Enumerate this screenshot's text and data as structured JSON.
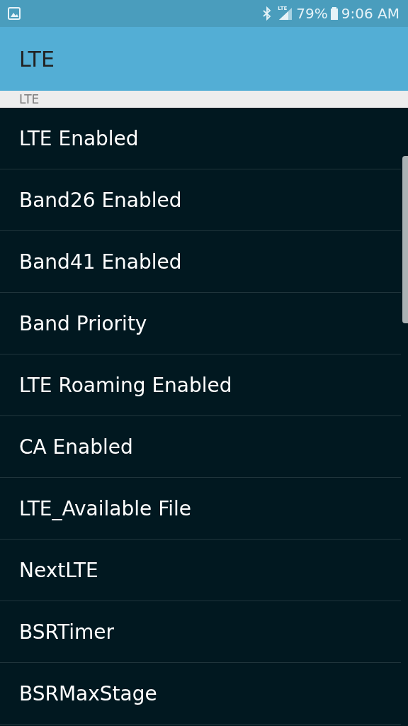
{
  "status_bar": {
    "battery": "79%",
    "time": "9:06 AM",
    "network": "LTE"
  },
  "app_bar": {
    "title": "LTE"
  },
  "section_header": "LTE",
  "items": [
    "LTE Enabled",
    "Band26 Enabled",
    "Band41 Enabled",
    "Band Priority",
    "LTE Roaming Enabled",
    "CA Enabled",
    "LTE_Available File",
    "NextLTE",
    "BSRTimer",
    "BSRMaxStage"
  ]
}
